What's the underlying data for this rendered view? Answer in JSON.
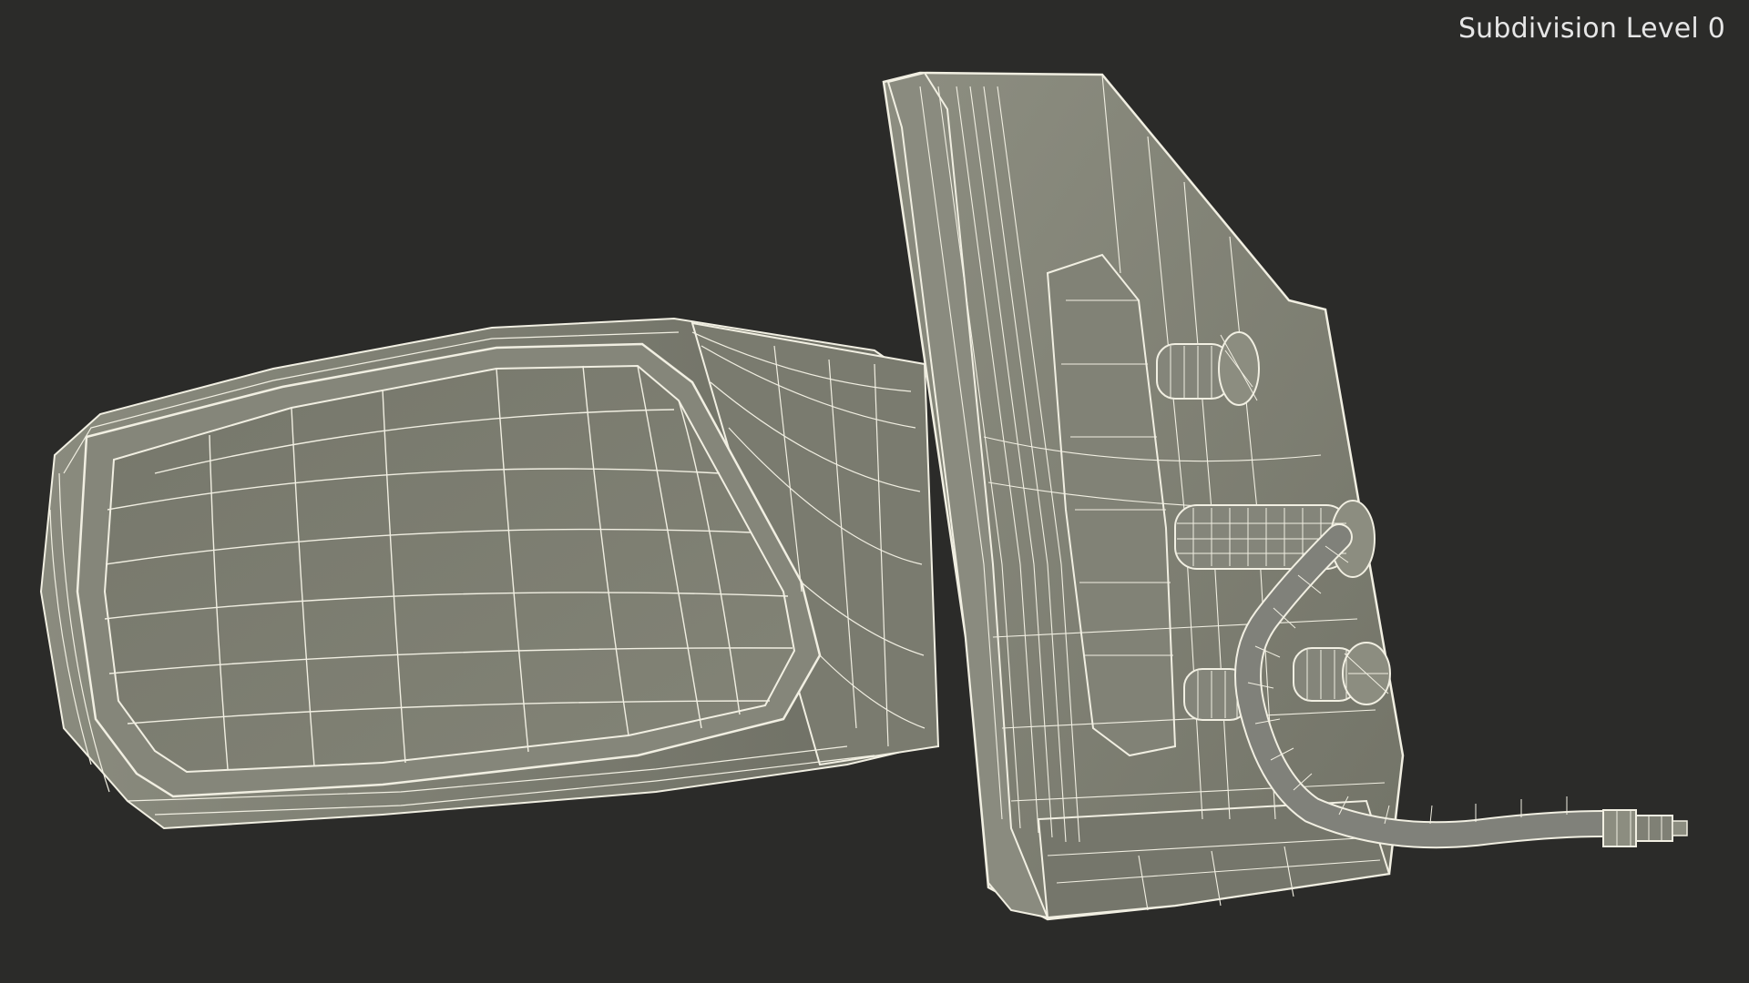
{
  "viewport": {
    "overlay_label": "Subdivision Level 0",
    "background_color": "#2b2b29",
    "model_shade_color": "#7e7f72",
    "wire_color": "#f1efe2"
  },
  "scene": {
    "subject": "car-side-mirror-wireframe-model"
  }
}
